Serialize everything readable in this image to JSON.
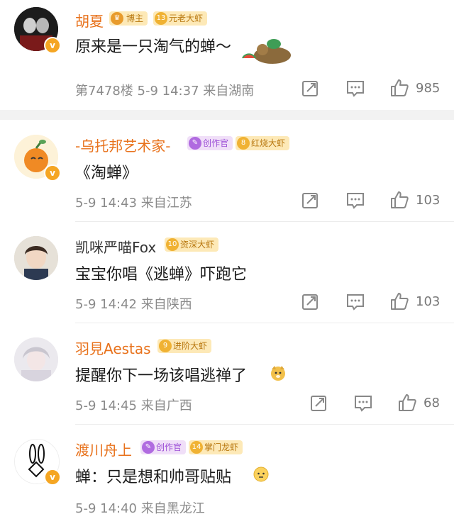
{
  "comments": [
    {
      "username": "胡夏",
      "badge1": "博主",
      "badge2_num": "13",
      "badge2": "元老大虾",
      "text": "原来是一只淘气的蝉～",
      "meta": "第7478楼  5-9 14:37  来自湖南",
      "likes": "985"
    },
    {
      "username": "-乌托邦艺术家-",
      "badge1": "创作官",
      "badge2_num": "8",
      "badge2": "红烧大虾",
      "text": "《淘蝉》",
      "meta": "5-9 14:43  来自江苏",
      "likes": "103"
    },
    {
      "username": "凯咪严喵Fox",
      "badge1_num": "10",
      "badge1": "资深大虾",
      "text": "宝宝你唱《逃蝉》吓跑它",
      "meta": "5-9 14:42  来自陕西",
      "likes": "103"
    },
    {
      "username": "羽見Aestas",
      "badge1_num": "9",
      "badge1": "进阶大虾",
      "text": "提醒你下一场该唱逃禅了",
      "meta": "5-9 14:45  来自广西",
      "likes": "68"
    },
    {
      "username": "渡川舟上",
      "badge1": "创作官",
      "badge2_num": "14",
      "badge2": "掌门龙虾",
      "text": "蝉：只是想和帅哥贴贴",
      "meta": "5-9 14:40  来自黑龙江"
    }
  ],
  "icons": [
    "share-icon",
    "comment-icon",
    "like-icon"
  ],
  "colors": {
    "username": "#e8721c",
    "badge_gold": "#fde9b7",
    "badge_purple": "#f0dff8",
    "verified": "#f5a623"
  }
}
